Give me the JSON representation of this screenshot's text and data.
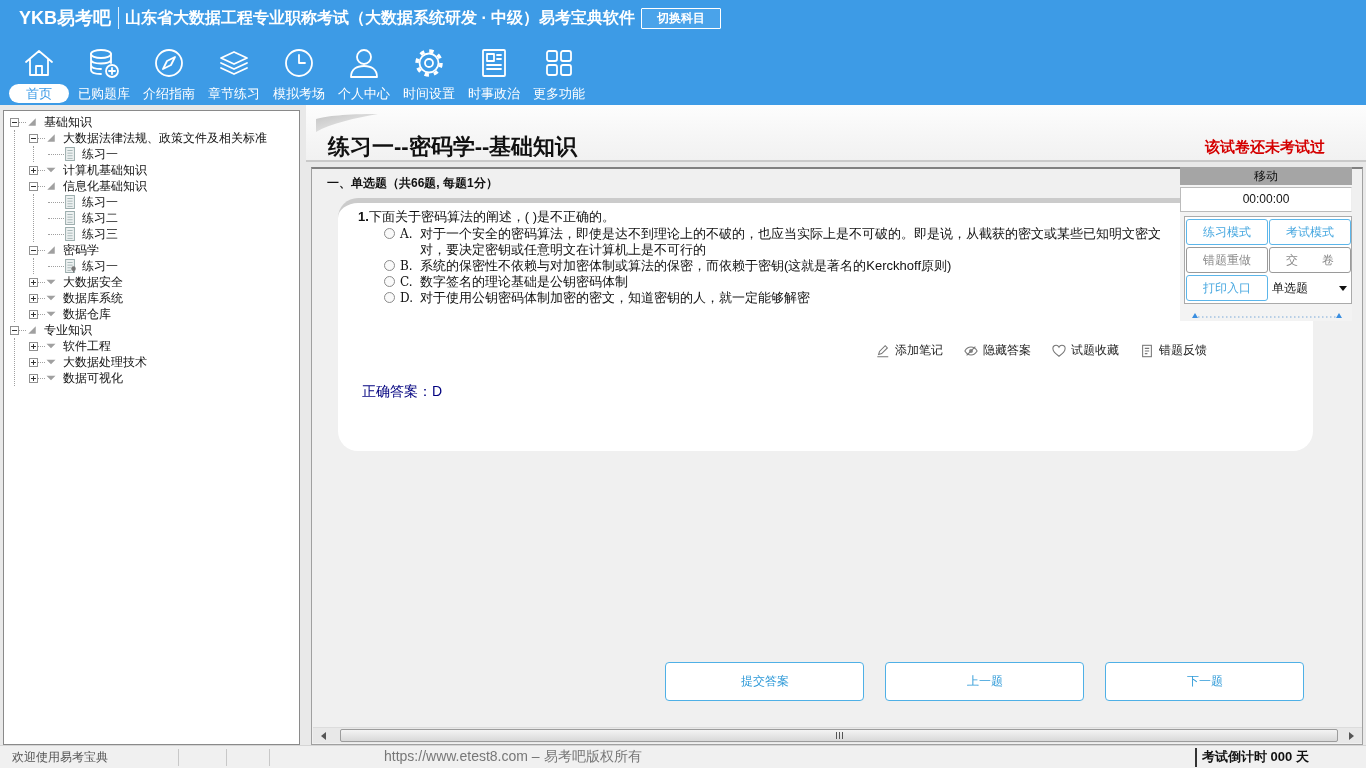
{
  "header": {
    "logo": "YKB易考吧",
    "title": "山东省大数据工程专业职称考试（大数据系统研发 · 中级）易考宝典软件",
    "switch_button": "切换科目"
  },
  "nav": [
    {
      "label": "首页",
      "selected": true
    },
    {
      "label": "已购题库",
      "selected": false
    },
    {
      "label": "介绍指南",
      "selected": false
    },
    {
      "label": "章节练习",
      "selected": false
    },
    {
      "label": "模拟考场",
      "selected": false
    },
    {
      "label": "个人中心",
      "selected": false
    },
    {
      "label": "时间设置",
      "selected": false
    },
    {
      "label": "时事政治",
      "selected": false
    },
    {
      "label": "更多功能",
      "selected": false
    }
  ],
  "tree": [
    {
      "label": "基础知识",
      "kind": "folder",
      "expanded": true,
      "selected": false,
      "children": [
        {
          "label": "大数据法律法规、政策文件及相关标准",
          "kind": "folder",
          "expanded": true,
          "selected": false,
          "children": [
            {
              "label": "练习一",
              "kind": "exercise",
              "selected": false
            }
          ]
        },
        {
          "label": "计算机基础知识",
          "kind": "folder",
          "expanded": false,
          "selected": false
        },
        {
          "label": "信息化基础知识",
          "kind": "folder",
          "expanded": true,
          "selected": false,
          "children": [
            {
              "label": "练习一",
              "kind": "exercise",
              "selected": false
            },
            {
              "label": "练习二",
              "kind": "exercise",
              "selected": false
            },
            {
              "label": "练习三",
              "kind": "exercise",
              "selected": false
            }
          ]
        },
        {
          "label": "密码学",
          "kind": "folder",
          "expanded": true,
          "selected": false,
          "children": [
            {
              "label": "练习一",
              "kind": "exercise",
              "selected": true
            }
          ]
        },
        {
          "label": "大数据安全",
          "kind": "folder",
          "expanded": false,
          "selected": false
        },
        {
          "label": "数据库系统",
          "kind": "folder",
          "expanded": false,
          "selected": false
        },
        {
          "label": "数据仓库",
          "kind": "folder",
          "expanded": false,
          "selected": false
        }
      ]
    },
    {
      "label": "专业知识",
      "kind": "folder",
      "expanded": true,
      "selected": false,
      "children": [
        {
          "label": "软件工程",
          "kind": "folder",
          "expanded": false,
          "selected": false
        },
        {
          "label": "大数据处理技术",
          "kind": "folder",
          "expanded": false,
          "selected": false
        },
        {
          "label": "数据可视化",
          "kind": "folder",
          "expanded": false,
          "selected": false
        }
      ]
    }
  ],
  "page_title": "练习一--密码学--基础知识",
  "exam_status": "该试卷还未考试过",
  "section_heading": "一、单选题（共66题, 每题1分）",
  "question": {
    "number": "1.",
    "text": "下面关于密码算法的阐述，( )是不正确的。",
    "options": [
      {
        "letter": "A.",
        "text": "对于一个安全的密码算法，即使是达不到理论上的不破的，也应当实际上是不可破的。即是说，从截获的密文或某些已知明文密文对，要决定密钥或任意明文在计算机上是不可行的",
        "selected": false
      },
      {
        "letter": "B.",
        "text": "系统的保密性不依赖与对加密体制或算法的保密，而依赖于密钥(这就是著名的Kerckhoff原则)",
        "selected": false
      },
      {
        "letter": "C.",
        "text": "数字签名的理论基础是公钥密码体制",
        "selected": false
      },
      {
        "letter": "D.",
        "text": "对于使用公钥密码体制加密的密文，知道密钥的人，就一定能够解密",
        "selected": false
      }
    ],
    "actions": [
      "添加笔记",
      "隐藏答案",
      "试题收藏",
      "错题反馈"
    ],
    "answer": "正确答案：D"
  },
  "bottom_buttons": [
    "提交答案",
    "上一题",
    "下一题"
  ],
  "tool_panel": {
    "title": "移动",
    "timer": "00:00:00",
    "buttons": [
      {
        "label": "练习模式",
        "disabled": false
      },
      {
        "label": "考试模式",
        "disabled": false
      },
      {
        "label": "错题重做",
        "disabled": true
      },
      {
        "label": "交　　卷",
        "disabled": true
      },
      {
        "label": "打印入口",
        "disabled": false
      }
    ],
    "type_select": "单选题"
  },
  "status_bar": {
    "welcome": "欢迎使用易考宝典",
    "copyright": "https://www.etest8.com – 易考吧版权所有",
    "countdown": "考试倒计时 000 天"
  }
}
